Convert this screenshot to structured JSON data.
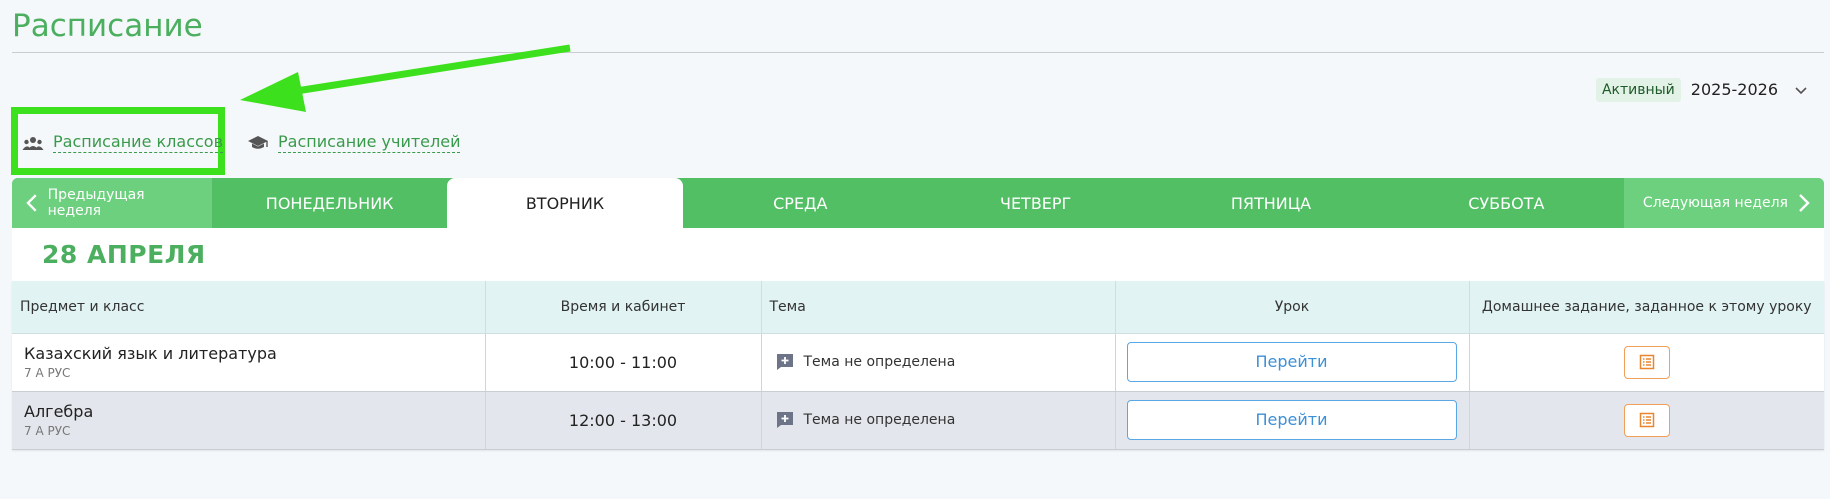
{
  "page": {
    "title": "Расписание"
  },
  "year_selector": {
    "status": "Активный",
    "year": "2025-2026",
    "icon": "chevron-down-icon"
  },
  "view_tabs": [
    {
      "label": "Расписание классов",
      "icon": "users-icon"
    },
    {
      "label": "Расписание учителей",
      "icon": "graduation-cap-icon"
    }
  ],
  "week_nav": {
    "prev_label": "Предыдущая неделя",
    "next_label": "Следующая неделя"
  },
  "days": [
    "ПОНЕДЕЛЬНИК",
    "ВТОРНИК",
    "СРЕДА",
    "ЧЕТВЕРГ",
    "ПЯТНИЦА",
    "СУББОТА"
  ],
  "active_day": "ВТОРНИК",
  "date_label": "28 АПРЕЛЯ",
  "table": {
    "headers": {
      "subject": "Предмет и класс",
      "time": "Время и кабинет",
      "topic": "Тема",
      "lesson": "Урок",
      "homework": "Домашнее задание, заданное к этому уроку"
    },
    "rows": [
      {
        "subject": "Казахский язык и литература",
        "class": "7 А РУС",
        "time": "10:00 - 11:00",
        "topic": "Тема не определена",
        "action": "Перейти"
      },
      {
        "subject": "Алгебра",
        "class": "7 А РУС",
        "time": "12:00 - 13:00",
        "topic": "Тема не определена",
        "action": "Перейти"
      }
    ]
  },
  "colors": {
    "accent": "#52bf65",
    "accent_light": "#6dd07f",
    "link_blue": "#3d8fd6",
    "homework_orange": "#f0a05a",
    "annotation_green": "#3de01c"
  }
}
